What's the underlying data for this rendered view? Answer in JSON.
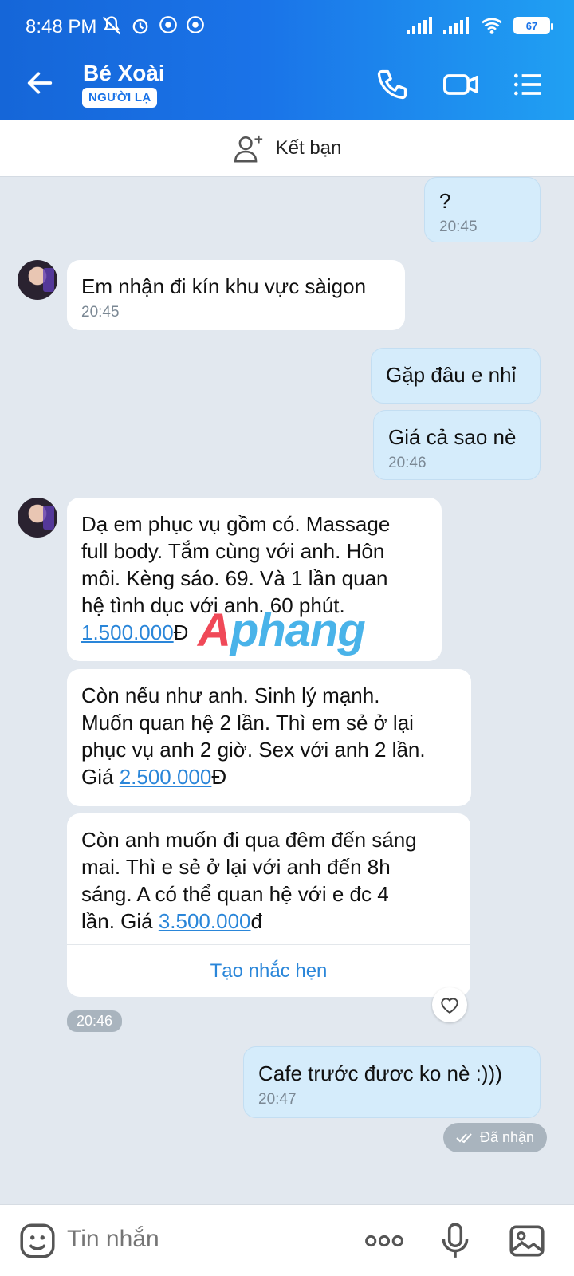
{
  "status_bar": {
    "time": "8:48 PM",
    "battery": "67"
  },
  "header": {
    "contact_name": "Bé Xoài",
    "badge": "NGƯỜI LẠ"
  },
  "add_friend": {
    "label": "Kết bạn"
  },
  "messages": [
    {
      "dir": "out",
      "text": "?",
      "time": "20:45"
    },
    {
      "dir": "in",
      "text": "Em nhận đi kín khu vực sàigon",
      "time": "20:45"
    },
    {
      "dir": "out",
      "text": "Gặp đâu e nhỉ"
    },
    {
      "dir": "out",
      "text": "Giá cả sao nè",
      "time": "20:46"
    },
    {
      "dir": "in",
      "lines": [
        "Dạ em phục vụ gồm có. Massage",
        "full body. Tắm cùng với anh. Hôn",
        "môi. Kèng sáo. 69. Và 1  lần quan",
        "hệ tình dục với anh. 60 phút."
      ],
      "price": "1.500.000",
      "suffix": "Đ"
    },
    {
      "dir": "in",
      "lines": [
        "Còn nếu như anh. Sinh lý mạnh.",
        "Muốn quan hệ 2 lần. Thì em sẻ ở lại",
        "phục vụ anh 2 giờ.  Sex với anh 2 lần."
      ],
      "prefix": "Giá ",
      "price": "2.500.000",
      "suffix": "Đ"
    },
    {
      "dir": "in",
      "lines": [
        "Còn anh muốn đi qua đêm đến sáng",
        "mai.  Thì e sẻ ở lại với anh đến 8h",
        "sáng. A có thể quan hệ với e đc 4"
      ],
      "prefix": "lần. Giá ",
      "price": "3.500.000",
      "suffix": "đ"
    },
    {
      "dir": "out",
      "text": "Cafe trước đươc ko nè :)))",
      "time": "20:47"
    }
  ],
  "reminder_button": "Tạo nhắc hẹn",
  "group_time": "20:46",
  "received_status": "Đã nhận",
  "watermark": {
    "part1": "A",
    "part2": "phang"
  },
  "composer": {
    "placeholder": "Tin nhắn"
  }
}
